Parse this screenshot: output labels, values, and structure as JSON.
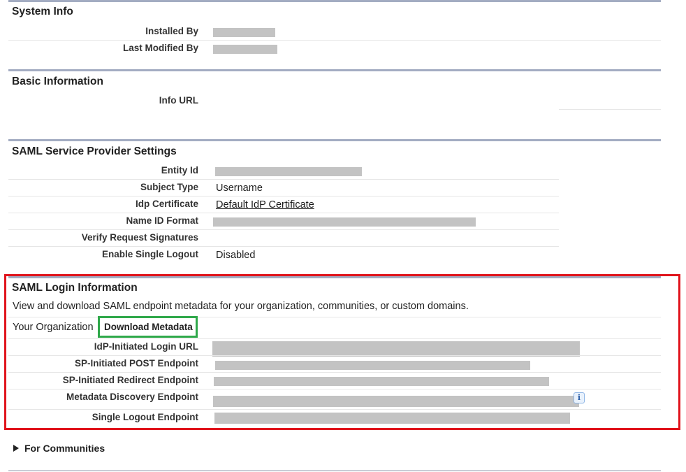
{
  "system_info": {
    "title": "System Info",
    "rows": [
      {
        "label": "Installed By",
        "value": ""
      },
      {
        "label": "Last Modified By",
        "value": ""
      }
    ]
  },
  "basic_information": {
    "title": "Basic Information",
    "rows": [
      {
        "label": "Info URL",
        "value": ""
      }
    ]
  },
  "saml_sp_settings": {
    "title": "SAML Service Provider Settings",
    "rows": [
      {
        "label": "Entity Id",
        "value": ""
      },
      {
        "label": "Subject Type",
        "value": "Username"
      },
      {
        "label": "Idp Certificate",
        "value": "Default IdP Certificate"
      },
      {
        "label": "Name ID Format",
        "value": ""
      },
      {
        "label": "Verify Request Signatures",
        "value": ""
      },
      {
        "label": "Enable Single Logout",
        "value": "Disabled"
      }
    ]
  },
  "saml_login_info": {
    "title": "SAML Login Information",
    "description": "View and download SAML endpoint metadata for your organization, communities, or custom domains.",
    "org_label": "Your Organization",
    "download_label": "Download Metadata",
    "rows": [
      {
        "label": "IdP-Initiated Login URL",
        "value": ""
      },
      {
        "label": "SP-Initiated POST Endpoint",
        "value": ""
      },
      {
        "label": "SP-Initiated Redirect Endpoint",
        "value": ""
      },
      {
        "label": "Metadata Discovery Endpoint",
        "value": ""
      },
      {
        "label": "Single Logout Endpoint",
        "value": ""
      }
    ],
    "info_icon": "info-icon"
  },
  "communities": {
    "label": "For Communities",
    "icon": "expand-triangle-icon"
  },
  "colors": {
    "section_rule": "#a3acc2",
    "highlight_red": "#e0141c",
    "highlight_green": "#2fa84a"
  }
}
